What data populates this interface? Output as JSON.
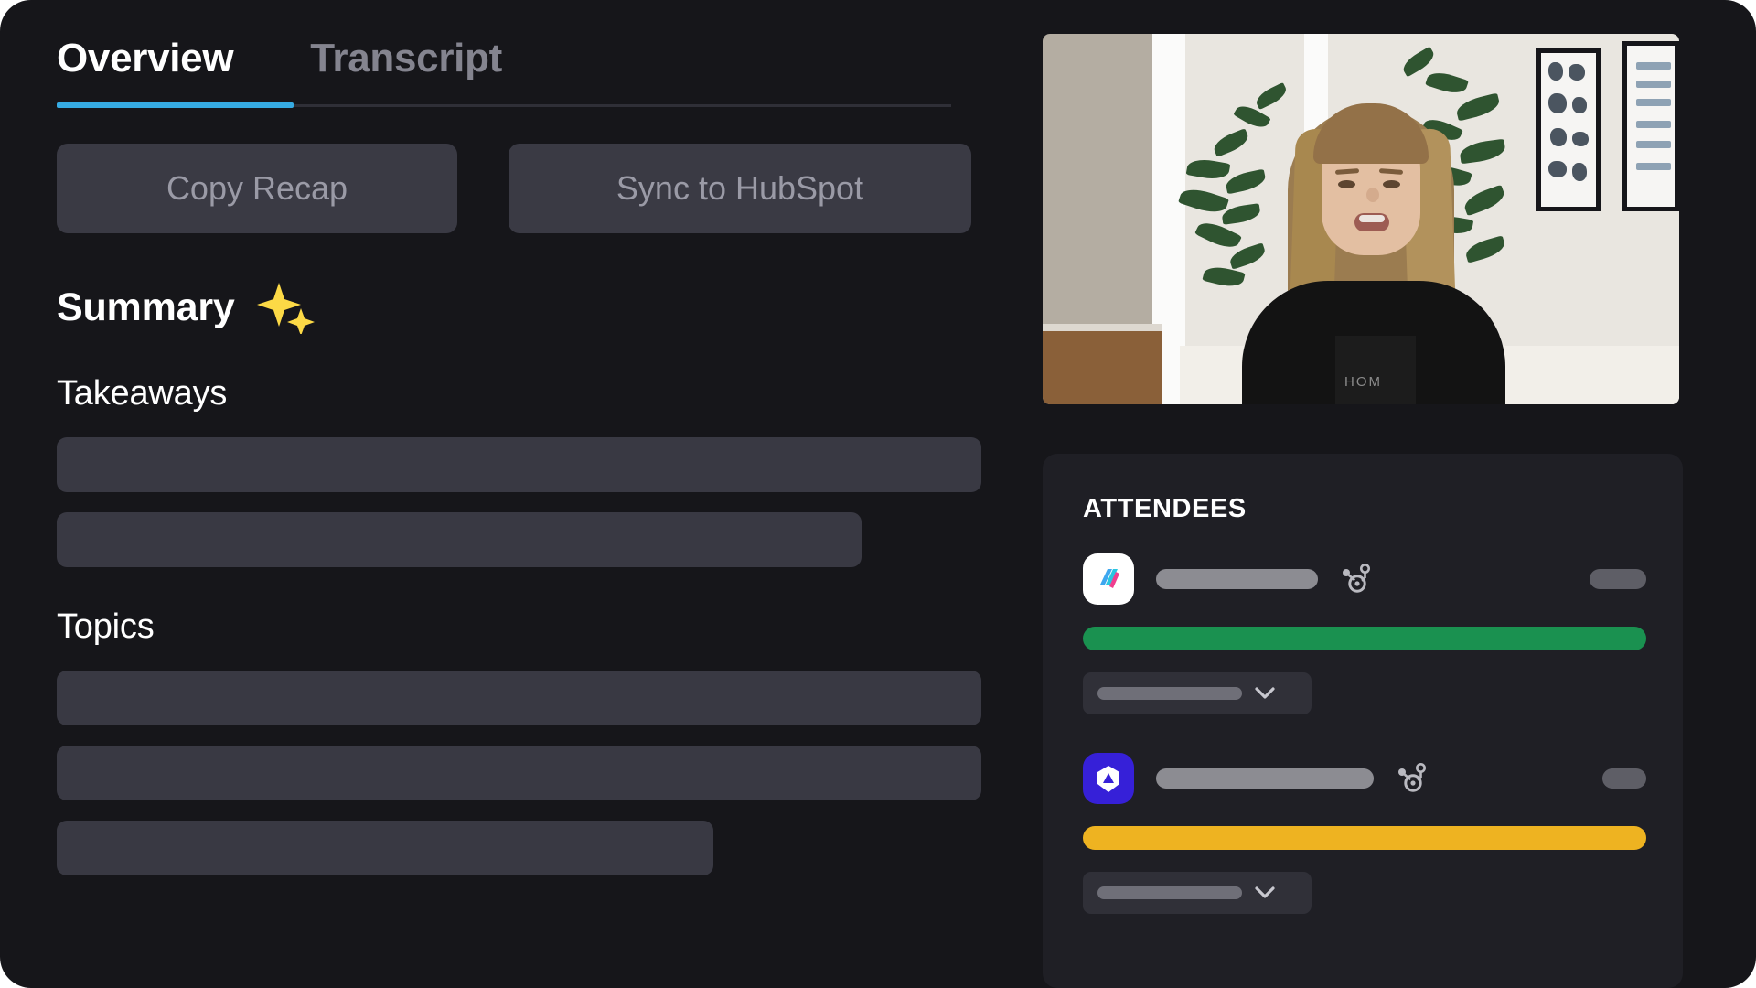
{
  "theme": {
    "page_background": "#16161a",
    "panel_background": "#1f1f25",
    "accent_blue": "#36abe3",
    "skeleton_dark": "#393943",
    "skeleton_light": "#8c8c92",
    "text_primary": "#ffffff",
    "text_muted": "#84848f",
    "button_background": "#3a3a44",
    "button_text": "#9a9aa6"
  },
  "tabs": [
    {
      "label": "Overview",
      "active": true,
      "name": "tab-overview"
    },
    {
      "label": "Transcript",
      "active": false,
      "name": "tab-transcript"
    }
  ],
  "actions": {
    "copy_recap_label": "Copy Recap",
    "sync_hubspot_label": "Sync to HubSpot"
  },
  "summary": {
    "title": "Summary",
    "sparkle_icon": "sparkles-icon",
    "sections": [
      {
        "label": "Takeaways",
        "placeholders": [
          {
            "width_class": "tw-100"
          },
          {
            "width_class": "tw-88"
          }
        ]
      },
      {
        "label": "Topics",
        "placeholders": [
          {
            "width_class": "tw-100"
          },
          {
            "width_class": "tw-100"
          },
          {
            "width_class": "tw-68"
          }
        ]
      }
    ]
  },
  "video": {
    "name": "meeting-video-thumbnail",
    "shirt_text": "HOM"
  },
  "attendees": {
    "title": "ATTENDEES",
    "items": [
      {
        "avatar_icon": "app-logo-avatar-icon",
        "avatar_style": "light",
        "name_skeleton_width": "name-w-1",
        "crm_icon": "hubspot-sprocket-icon",
        "tag_skeleton_width": "tag-w-1",
        "status_color": "#1a9150",
        "status_label": "status-bar-green",
        "select_icon": "chevron-down-icon"
      },
      {
        "avatar_icon": "diamond-logo-avatar-icon",
        "avatar_style": "indigo",
        "name_skeleton_width": "name-w-2",
        "crm_icon": "hubspot-sprocket-icon",
        "tag_skeleton_width": "tag-w-2",
        "status_color": "#eeb321",
        "status_label": "status-bar-amber",
        "select_icon": "chevron-down-icon"
      }
    ]
  }
}
